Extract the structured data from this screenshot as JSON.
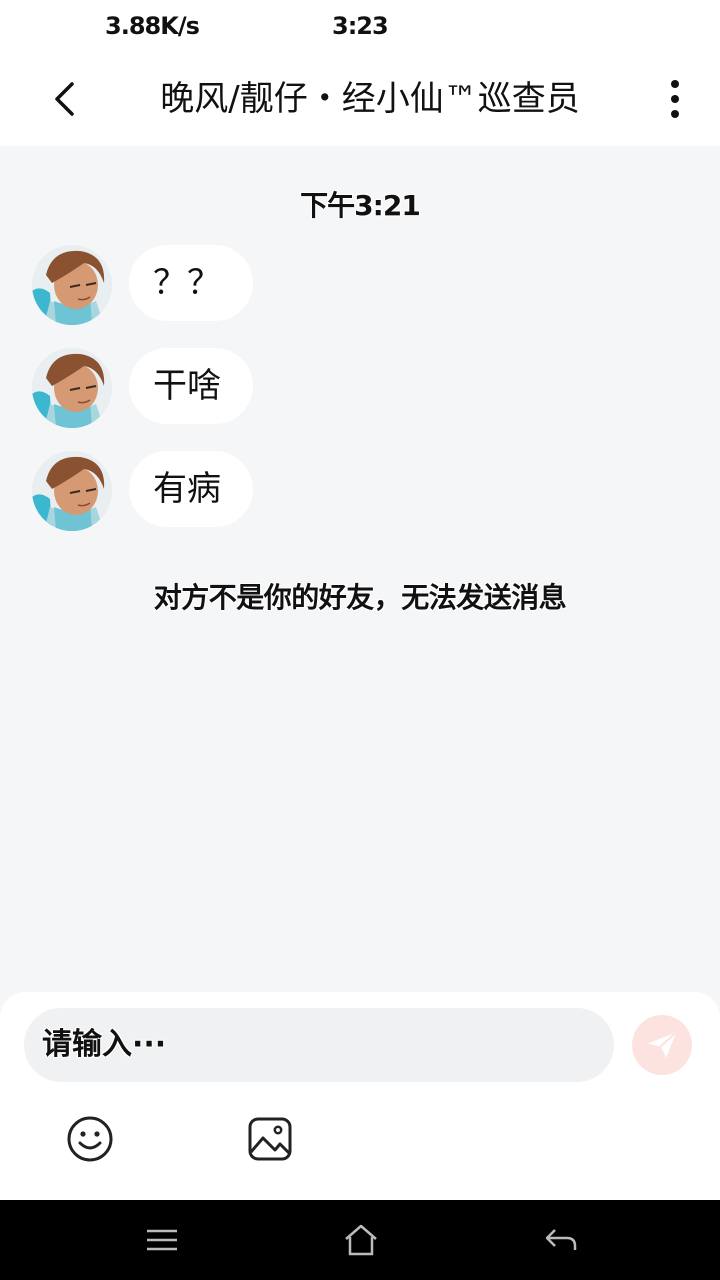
{
  "status_bar": {
    "network_speed": "3.88K/s",
    "time": "3:23"
  },
  "header": {
    "back_icon": "chevron-left-icon",
    "title": "晚风/靓仔・经小仙™巡查员",
    "more_icon": "more-vertical-icon"
  },
  "chat": {
    "timestamp": "下午3:21",
    "messages": [
      {
        "text": "？？"
      },
      {
        "text": "干啥"
      },
      {
        "text": "有病"
      }
    ],
    "system_notice": "对方不是你的好友，无法发送消息"
  },
  "input": {
    "placeholder": "请输入···",
    "send_icon": "paper-plane-icon",
    "send_color": "#fde3df",
    "tools": [
      "smiley-icon",
      "image-icon"
    ]
  },
  "nav": {
    "icons": [
      "menu-icon",
      "home-icon",
      "back-arrow-icon"
    ]
  }
}
